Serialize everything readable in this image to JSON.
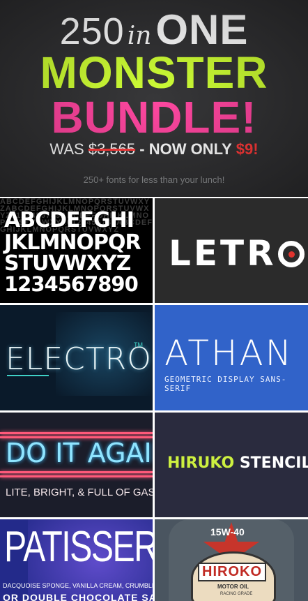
{
  "banner": {
    "n250": "250",
    "in": "in",
    "one": "ONE",
    "monster": "MONSTER",
    "bundle": "BUNDLE!",
    "was": "WAS",
    "old_price": "$3,565",
    "now_only": "- NOW ONLY",
    "new_price": "$9!",
    "tagline": "250+ fonts for less than your lunch!"
  },
  "tiles": {
    "alphabet": {
      "bg_text": "ABCDEFGHIJKLMNOPQRSTUVWXYZABCDEFGHIJKLMNOPQRSTUVWXYZ0123456789ABCDEFGHIJKLMNOPQRSTUVWXYZ0123456789ABCDEFGHIJKLMNOPQRSTUVWXYZ",
      "row1": "ABCDEFGHI",
      "row2": "JKLMNOPQR",
      "row3": "STUVWXYZ",
      "row4": "1234567890"
    },
    "letro": {
      "name": "LETR"
    },
    "electro": {
      "name": "ELECTRO",
      "tm": "TM"
    },
    "athan": {
      "name": "ATHAN",
      "subtitle": "GEOMETRIC DISPLAY SANS-SERIF"
    },
    "doitagain": {
      "title": "DO IT AGAIN",
      "subtitle": "LITE, BRIGHT, & FULL OF GAS"
    },
    "hiruko": {
      "part1": "HIRUKO",
      "part2": " STENCIL",
      "reg": "®"
    },
    "patisserie": {
      "title": "PATISSERIE",
      "subtitle": "DACQUOISE SPONGE, VANILLA CREAM, CRUMBLE & FRESH STRAWBERRIES",
      "subtitle2": "OR DOUBLE CHOCOLATE SAUS"
    },
    "hiroko": {
      "top": "15W-40",
      "name": "HIROKO",
      "motor": "MOTOR OIL",
      "racing": "RACING GRADE"
    }
  },
  "colors": {
    "banner_bg": "#2b2b2d",
    "monster": "#ccff2b",
    "bundle": "#ff3d9b",
    "price_red": "#ff3333",
    "athan_bg": "#3163c9",
    "hiruko_green": "#cdf040"
  }
}
